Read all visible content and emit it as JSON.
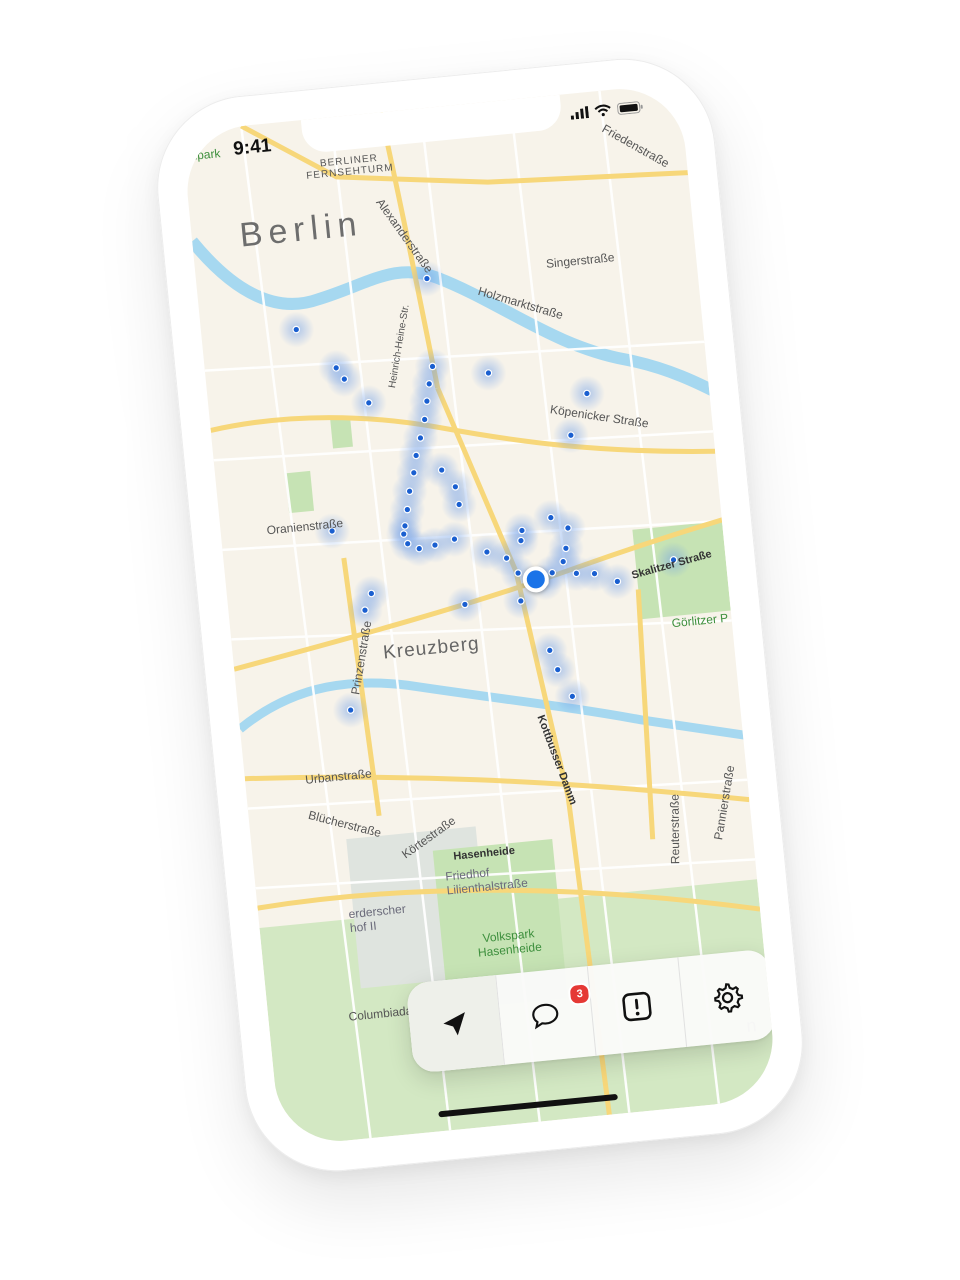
{
  "status": {
    "time": "9:41"
  },
  "map": {
    "city": "Berlin",
    "district": "Kreuzberg",
    "landmark": "BERLINER\nFERNSEHTURM",
    "streets": [
      "Friedenstraße",
      "Alexanderstraße",
      "Singerstraße",
      "Holzmarktstraße",
      "Köpenicker Straße",
      "Oranienstraße",
      "Skalitzer Straße",
      "Prinzenstraße",
      "Urbanstraße",
      "Blücherstraße",
      "Körtestraße",
      "Hasenheide",
      "Kottbusser Damm",
      "Reuterstraße",
      "Pannierstraße",
      "Columbiadamm",
      "Heinrich-Heine-Str."
    ],
    "parks": [
      "Görlitzer P",
      "Volkspark\nHasenheide",
      "oupark"
    ],
    "cemeteries": [
      "Friedhof\nLilienthalstraße",
      "erderscher\nhof II"
    ],
    "edge_text": "n"
  },
  "tabbar": {
    "tabs": [
      {
        "name": "location",
        "icon": "location-arrow-icon"
      },
      {
        "name": "messages",
        "icon": "chat-bubble-icon",
        "badge": "3"
      },
      {
        "name": "report",
        "icon": "exclamation-icon"
      },
      {
        "name": "settings",
        "icon": "gear-icon"
      }
    ]
  },
  "colors": {
    "accent": "#1a73e8",
    "badge": "#e53935",
    "water": "#a6d8f0",
    "park": "#c6e3b4",
    "road": "#f7d77a"
  }
}
